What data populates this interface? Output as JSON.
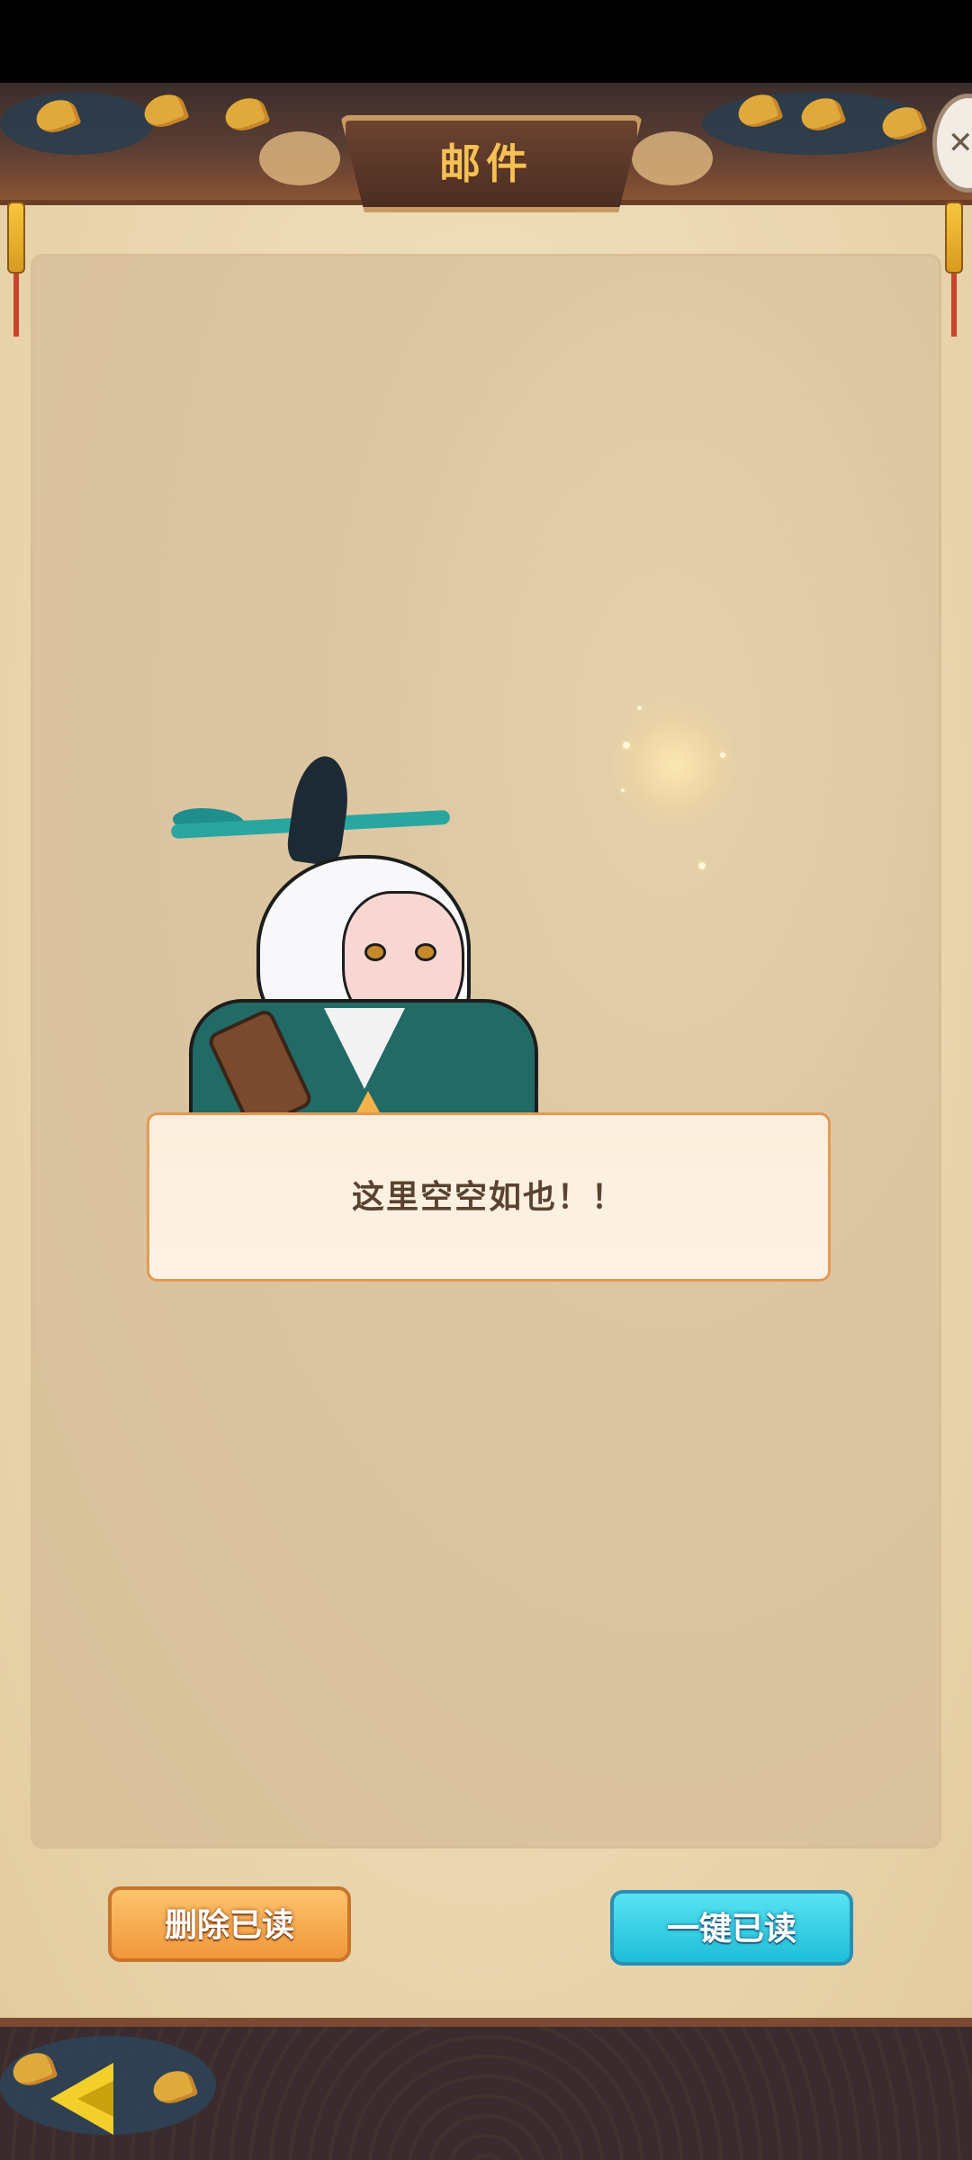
{
  "screen": {
    "title": "邮件",
    "empty_message": "这里空空如也！！"
  },
  "buttons": {
    "delete_read": "删除已读",
    "read_all": "一键已读"
  },
  "icons": {
    "close": "close-icon",
    "back": "back-arrow-icon"
  },
  "colors": {
    "title_gold": "#f5c156",
    "delete_button": "#f2983b",
    "read_all_button": "#1fbed8",
    "bubble_border": "#e39a52"
  }
}
